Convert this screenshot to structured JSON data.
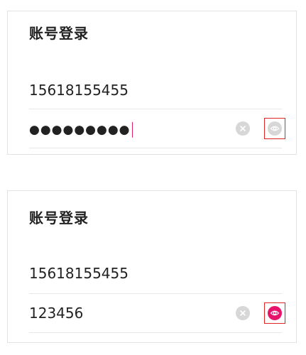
{
  "colors": {
    "accent": "#e8146c",
    "icon_inactive": "#d7d7d7",
    "highlight_border": "#e02424"
  },
  "panel_hidden": {
    "title": "账号登录",
    "phone_value": "15618155455",
    "password_masked": "●●●●●●●●●",
    "clear_icon": "clear-icon",
    "eye_icon": "eye-icon",
    "password_visible": false
  },
  "panel_shown": {
    "title": "账号登录",
    "phone_value": "15618155455",
    "password_value": "123456",
    "clear_icon": "clear-icon",
    "eye_icon": "eye-icon",
    "password_visible": true
  }
}
